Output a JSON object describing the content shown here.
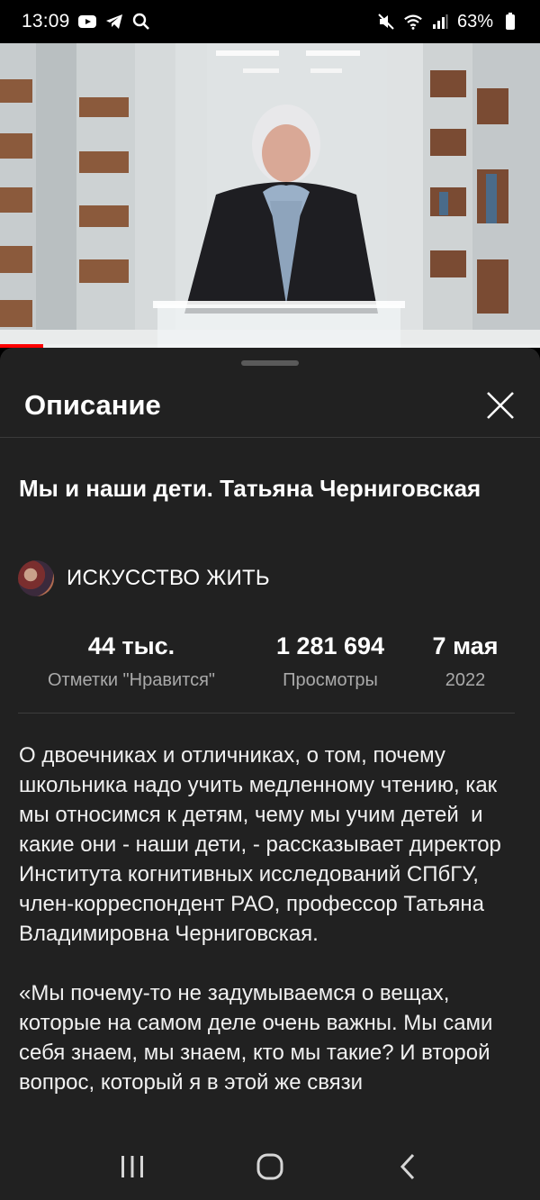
{
  "status_bar": {
    "time": "13:09",
    "battery": "63%",
    "icons_left": [
      "youtube-icon",
      "telegram-icon",
      "search-icon"
    ],
    "icons_right": [
      "mute-icon",
      "wifi-icon",
      "signal-icon",
      "battery-icon"
    ]
  },
  "video": {
    "progress_fraction": 0.08,
    "progress_color": "#ff0000"
  },
  "sheet": {
    "title": "Описание",
    "close_icon": "close-icon"
  },
  "video_info": {
    "title": "Мы и наши дети. Татьяна Черниговская",
    "channel_name": "ИСКУССТВО ЖИТЬ"
  },
  "stats": {
    "likes_value": "44 тыс.",
    "likes_label": "Отметки \"Нравится\"",
    "views_value": "1 281 694",
    "views_label": "Просмотры",
    "date_value": "7 мая",
    "date_label": "2022"
  },
  "description": {
    "text": "О двоечниках и отличниках, о том, почему школьника надо учить медленному чтению, как мы относимся к детям, чему мы учим детей  и какие они - наши дети, - рассказывает директор Института когнитивных исследований СПбГУ, член-корреспондент РАО, профессор Татьяна Владимировна Черниговская.\n\n«Мы почему-то не задумываемся о вещах, которые на самом деле очень важны. Мы сами себя знаем, мы знаем, кто мы такие? И второй вопрос, который я в этой же связи"
  },
  "nav_bar": {
    "icons": [
      "recent-apps-icon",
      "home-icon",
      "back-icon"
    ]
  },
  "colors": {
    "sheet_bg": "#212121",
    "secondary_text": "#aaaaaa",
    "accent": "#ff0000"
  }
}
